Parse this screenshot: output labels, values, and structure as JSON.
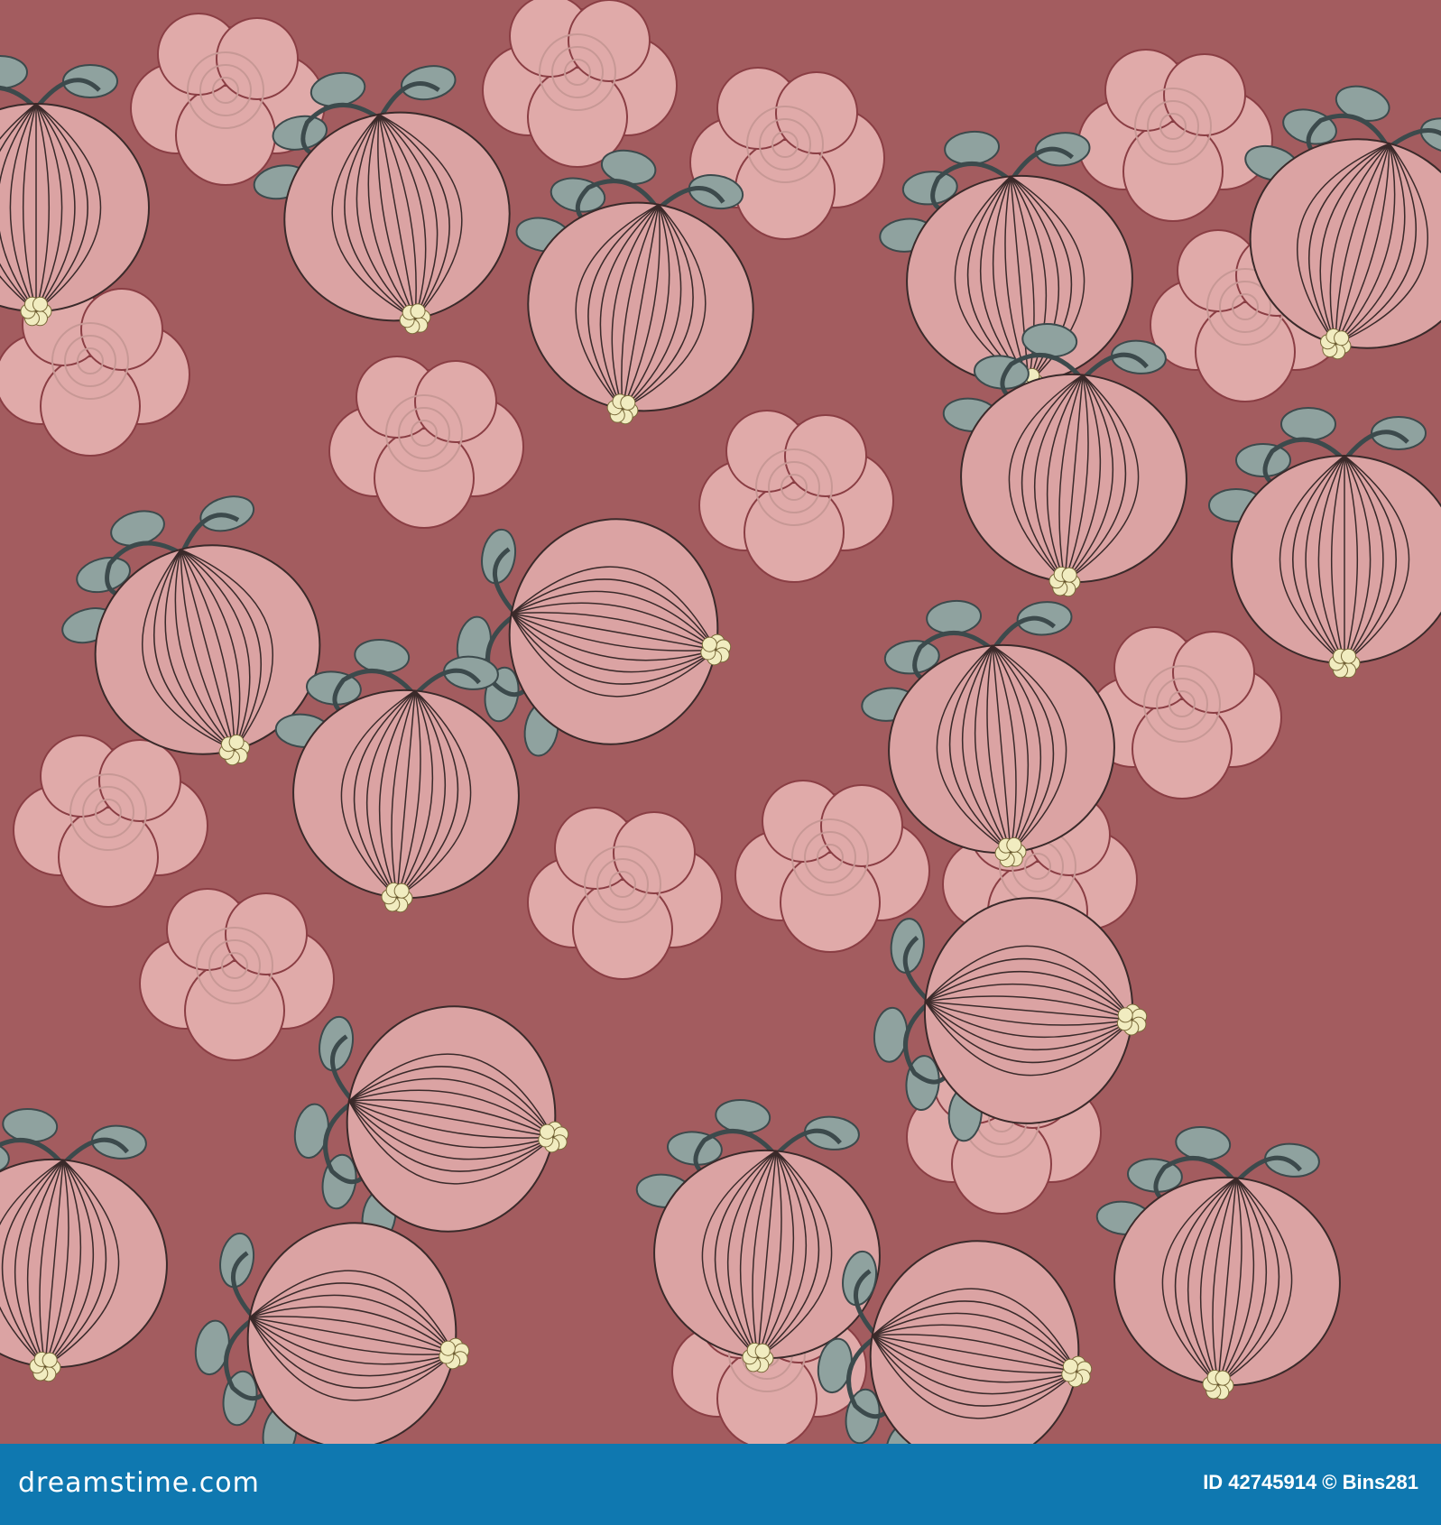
{
  "image": {
    "watermark": "dreamstime",
    "colors": {
      "background": "#a35c5f",
      "onion": "#dba3a3",
      "cloud": "#e0aaa9",
      "leaf": "#8fa29f",
      "vine": "#3c4a4c",
      "flower": "#f1ecc0",
      "footer": "#0f78b0"
    }
  },
  "footer": {
    "logo": "dreamstime.com",
    "credit": "ID 42745914 © Bins281"
  }
}
